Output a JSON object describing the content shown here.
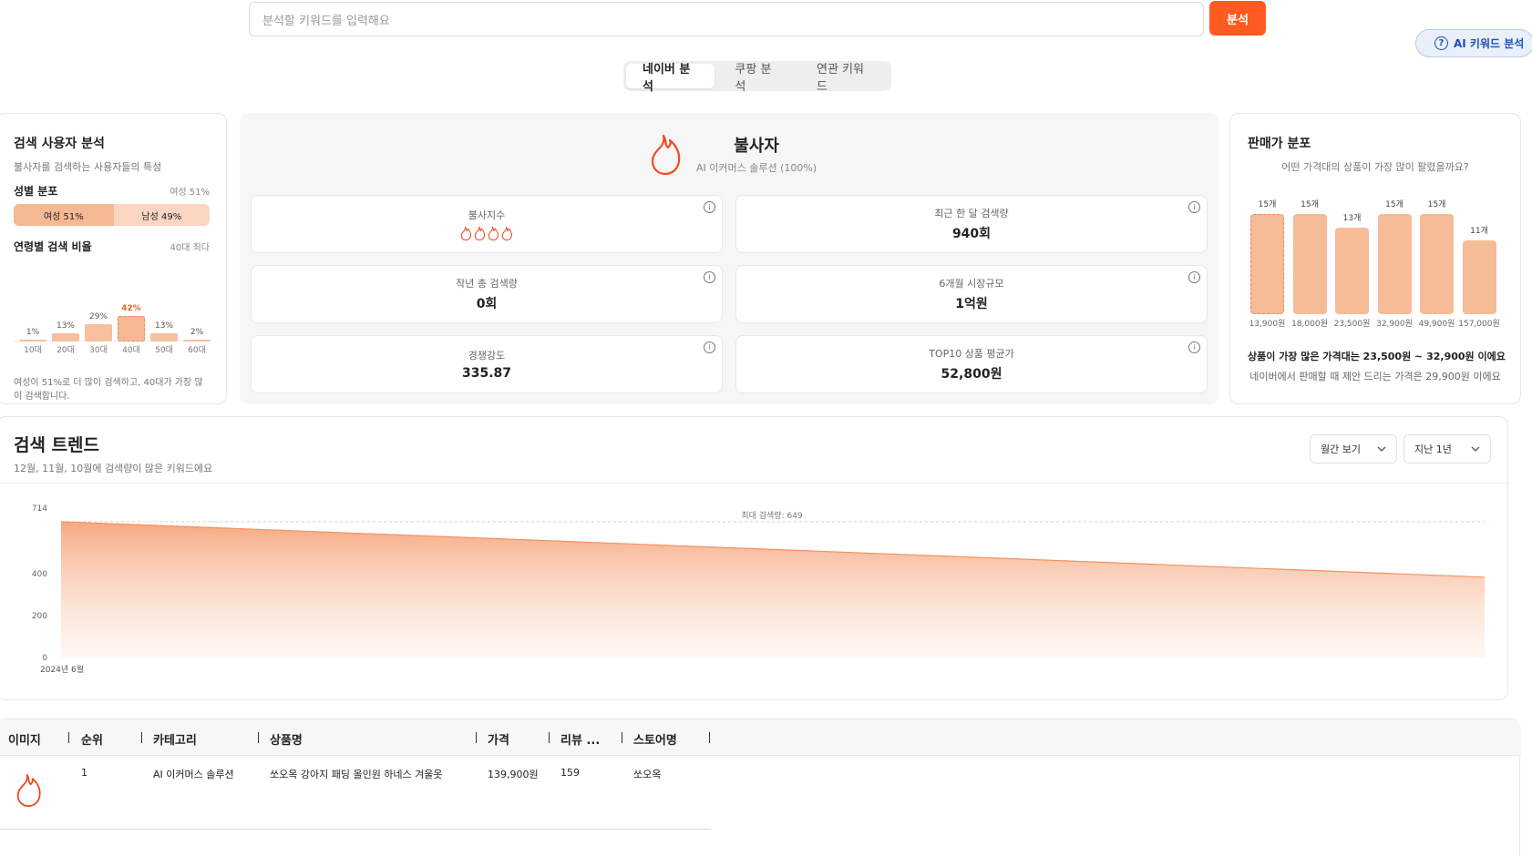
{
  "search": {
    "placeholder": "분석할 키워드를 입력해요",
    "button": "분석"
  },
  "ai_button": "AI 키워드 분석",
  "tabs": [
    {
      "label": "네이버 분석",
      "active": true
    },
    {
      "label": "쿠팡 분석",
      "active": false
    },
    {
      "label": "연관 키워드",
      "active": false
    }
  ],
  "user_analysis": {
    "title": "검색 사용자 분석",
    "subtitle": "불사자를 검색하는 사용자들의 특성",
    "gender_title": "성별 분포",
    "gender_summary": "여성 51%",
    "female_label": "여성 51%",
    "male_label": "남성 49%",
    "female_pct": 51,
    "age_title": "연령별 검색 비율",
    "age_summary": "40대 최다",
    "ages": [
      {
        "label": "10대",
        "pct_label": "1%",
        "value": 1
      },
      {
        "label": "20대",
        "pct_label": "13%",
        "value": 13
      },
      {
        "label": "30대",
        "pct_label": "29%",
        "value": 29
      },
      {
        "label": "40대",
        "pct_label": "42%",
        "value": 42
      },
      {
        "label": "50대",
        "pct_label": "13%",
        "value": 13
      },
      {
        "label": "60대",
        "pct_label": "2%",
        "value": 2
      }
    ],
    "note": "여성이 51%로 더 많이 검색하고, 40대가 가장 많이 검색합니다."
  },
  "keyword": {
    "name": "불사자",
    "category": "AI 이커머스 솔루션 (100%)",
    "metrics": [
      {
        "label": "불사지수",
        "value": "",
        "flames": 4
      },
      {
        "label": "최근 한 달 검색량",
        "value": "940회"
      },
      {
        "label": "작년 총 검색량",
        "value": "0회"
      },
      {
        "label": "6개월 시장규모",
        "value": "1억원"
      },
      {
        "label": "경쟁강도",
        "value": "335.87"
      },
      {
        "label": "TOP10 상품 평균가",
        "value": "52,800원"
      }
    ]
  },
  "price_dist": {
    "title": "판매가 분포",
    "subtitle": "어떤 가격대의 상품이 가장 많이 팔렸을까요?",
    "footer_main": "상품이 가장 많은 가격대는 23,500원 ~ 32,900원 이에요",
    "footer_sub": "네이버에서 판매할 때 제안 드리는 가격은 29,900원 이에요"
  },
  "chart_data": [
    {
      "type": "bar",
      "categories": [
        "13,900원",
        "18,000원",
        "23,500원",
        "32,900원",
        "49,900원",
        "157,000원"
      ],
      "values": [
        15,
        15,
        13,
        15,
        15,
        11
      ],
      "value_labels": [
        "15개",
        "15개",
        "13개",
        "15개",
        "15개",
        "11개"
      ],
      "title": "판매가 분포"
    },
    {
      "type": "area",
      "title": "검색 트렌드",
      "x": [
        "2024년 6월"
      ],
      "series": [
        {
          "values": [
            649,
            384
          ]
        }
      ],
      "ylim": [
        0,
        714
      ],
      "yticks": [
        0,
        200,
        400,
        714
      ],
      "annotation": "최대 검색량: 649"
    }
  ],
  "trend": {
    "title": "검색 트렌드",
    "subtitle": "12월, 11월, 10월에 검색량이 많은 키워드에요",
    "period_select": "월간 보기",
    "range_select": "지난 1년",
    "x_first_label": "2024년 6월",
    "annotation": "최대 검색량: 649"
  },
  "table": {
    "headers": [
      "이미지",
      "순위",
      "카테고리",
      "상품명",
      "가격",
      "리뷰 ...",
      "스토어명"
    ],
    "rows": [
      {
        "rank": "1",
        "category": "AI 이커머스 솔루션",
        "name": "쏘오옥 강아지 패딩 올인원 하네스 겨울옷",
        "price": "139,900원",
        "reviews": "159",
        "store": "쏘오옥"
      }
    ]
  },
  "colors": {
    "accent": "#ff5a1f",
    "bar": "#f6bb97",
    "ai_button": "#1f4fb8"
  }
}
